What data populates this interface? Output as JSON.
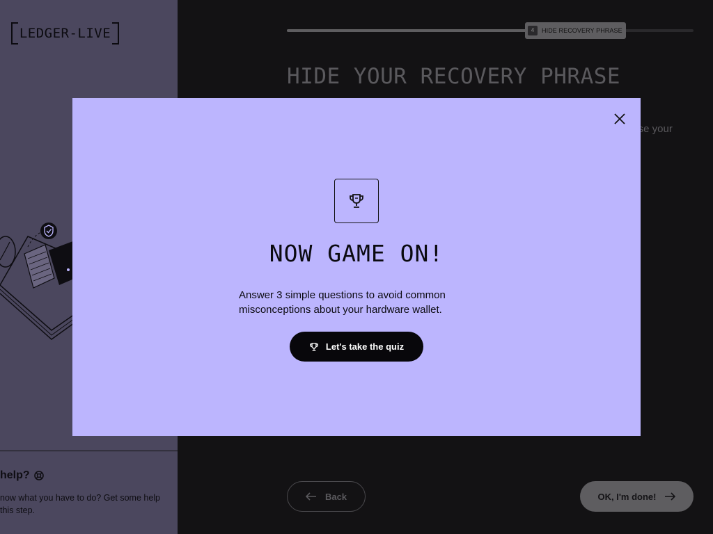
{
  "sidebar": {
    "logo_text": "LEDGER-LIVE",
    "help_title": "help?",
    "help_text": "now what you have to do? Get some help this step."
  },
  "main": {
    "progress_fraction": 0.6,
    "step_number": "4",
    "step_label": "HIDE RECOVERY PHRASE",
    "title": "HIDE YOUR RECOVERY PHRASE",
    "behind_text_fragment": "t use your",
    "back_label": "Back",
    "done_label": "OK, I'm done!"
  },
  "modal": {
    "title": "NOW GAME ON!",
    "description": "Answer 3 simple questions to avoid common misconceptions about your hardware wallet.",
    "quiz_button_label": "Let's take the quiz"
  },
  "colors": {
    "sidebar_bg": "#4b475e",
    "main_bg": "#131214",
    "modal_bg": "#bcb5fe",
    "button_dark": "#08070b"
  },
  "icons": [
    "help-icon",
    "trophy-icon",
    "close-icon",
    "arrow-left-icon",
    "arrow-right-icon"
  ]
}
